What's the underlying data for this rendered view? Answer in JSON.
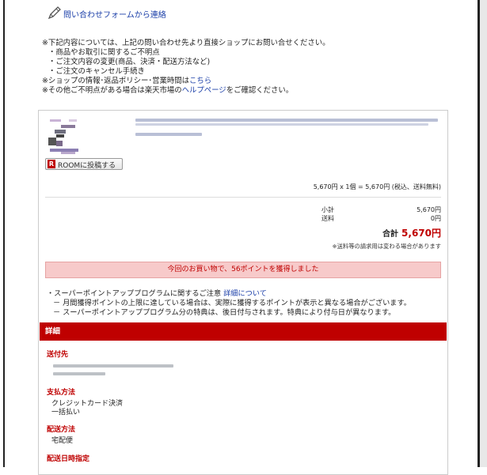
{
  "contact": {
    "link_label": "問い合わせフォームから連絡",
    "icon": "pen-icon"
  },
  "notes": {
    "line1": "※下記内容については、上記の問い合わせ先より直接ショップにお問い合せください。",
    "bullets": [
      "・商品やお取引に関するご不明点",
      "・ご注文内容の変更(商品、決済・配送方法など)",
      "・ご注文のキャンセル手続き"
    ],
    "shop_info_prefix": "※ショップの情報･返品ポリシー･営業時間は",
    "shop_info_link": "こちら",
    "help_prefix": "※その他ご不明点がある場合は楽天市場の",
    "help_link": "ヘルプページ",
    "help_suffix": "をご確認ください。"
  },
  "item": {
    "room_button": "ROOMに投稿する",
    "calc_line": "5,670円 x 1個 = 5,670円 (税込、送料無料)"
  },
  "summary": {
    "subtotal_label": "小計",
    "subtotal_value": "5,670円",
    "shipping_label": "送料",
    "shipping_value": "0円",
    "total_label": "合計",
    "total_value": "5,670円",
    "fee_note": "※送料等の請求用は変わる場合があります"
  },
  "points": {
    "message": "今回のお買い物で、56ポイントを獲得しました"
  },
  "super_point": {
    "title_prefix": "・スーパーポイントアッププログラムに関するご注意",
    "title_link": "詳細について",
    "line1": "－ 月間獲得ポイントの上限に達している場合は、実際に獲得するポイントが表示と異なる場合がございます。",
    "line2": "－ スーパーポイントアッププログラム分の特典は、後日付与されます。特典により付与日が異なります。"
  },
  "details": {
    "heading": "詳細",
    "sections": [
      {
        "heading": "送付先"
      },
      {
        "heading": "支払方法",
        "lines": [
          "クレジットカード決済",
          "一括払い"
        ]
      },
      {
        "heading": "配送方法",
        "lines": [
          "宅配便"
        ]
      },
      {
        "heading": "配送日時指定"
      }
    ]
  },
  "colors": {
    "accent": "#bf0000",
    "link": "#1a3ea8",
    "points_bg": "#f7caca"
  }
}
